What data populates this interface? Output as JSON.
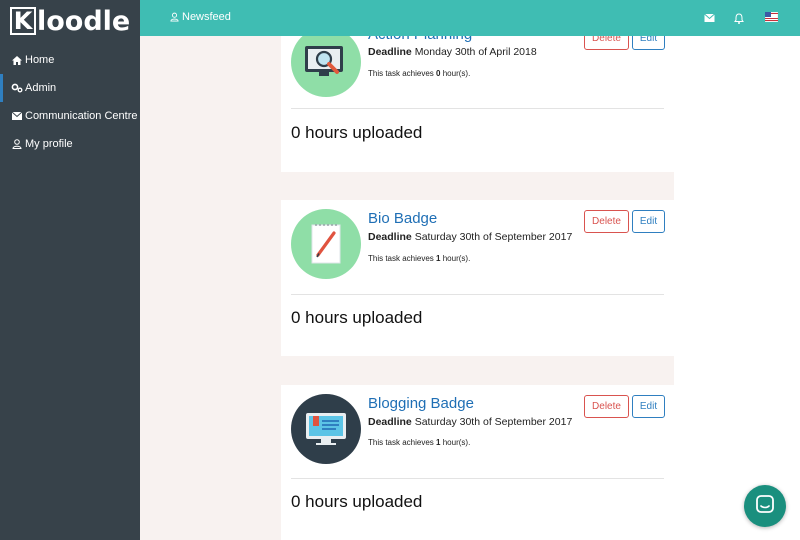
{
  "brand": {
    "logo_letter": "K",
    "logo_rest": "loodle"
  },
  "sidebar": {
    "items": [
      {
        "label": "Home",
        "icon": "home-icon"
      },
      {
        "label": "Admin",
        "icon": "cogs-icon"
      },
      {
        "label": "Communication Centre",
        "icon": "envelope-icon"
      },
      {
        "label": "My profile",
        "icon": "user-icon"
      }
    ]
  },
  "topbar": {
    "newsfeed_label": "Newsfeed",
    "icons": [
      "envelope-icon",
      "bell-icon",
      "flag-icon"
    ]
  },
  "colors": {
    "sidebar_bg": "#37424a",
    "topbar_bg": "#3fbdb3",
    "link_blue": "#1f6fb5",
    "delete_red": "#d9534f",
    "edit_blue": "#2f7fc0",
    "chat_green": "#1a8f7e"
  },
  "tasks": [
    {
      "title": "Action Planning",
      "deadline_label": "Deadline",
      "deadline_value": "Monday 30th of April 2018",
      "achieves_prefix": "This task achieves",
      "hours": "0",
      "achieves_suffix": "hour(s).",
      "delete_label": "Delete",
      "edit_label": "Edit",
      "uploaded": "0 hours uploaded",
      "icon": "magnifier-monitor-icon"
    },
    {
      "title": "Bio Badge",
      "deadline_label": "Deadline",
      "deadline_value": "Saturday 30th of September 2017",
      "achieves_prefix": "This task achieves",
      "hours": "1",
      "achieves_suffix": "hour(s).",
      "delete_label": "Delete",
      "edit_label": "Edit",
      "uploaded": "0 hours uploaded",
      "icon": "notepad-pencil-icon"
    },
    {
      "title": "Blogging Badge",
      "deadline_label": "Deadline",
      "deadline_value": "Saturday 30th of September 2017",
      "achieves_prefix": "This task achieves",
      "hours": "1",
      "achieves_suffix": "hour(s).",
      "delete_label": "Delete",
      "edit_label": "Edit",
      "uploaded": "0 hours uploaded",
      "icon": "monitor-blog-icon"
    }
  ],
  "chat": {
    "icon": "chat-icon"
  }
}
